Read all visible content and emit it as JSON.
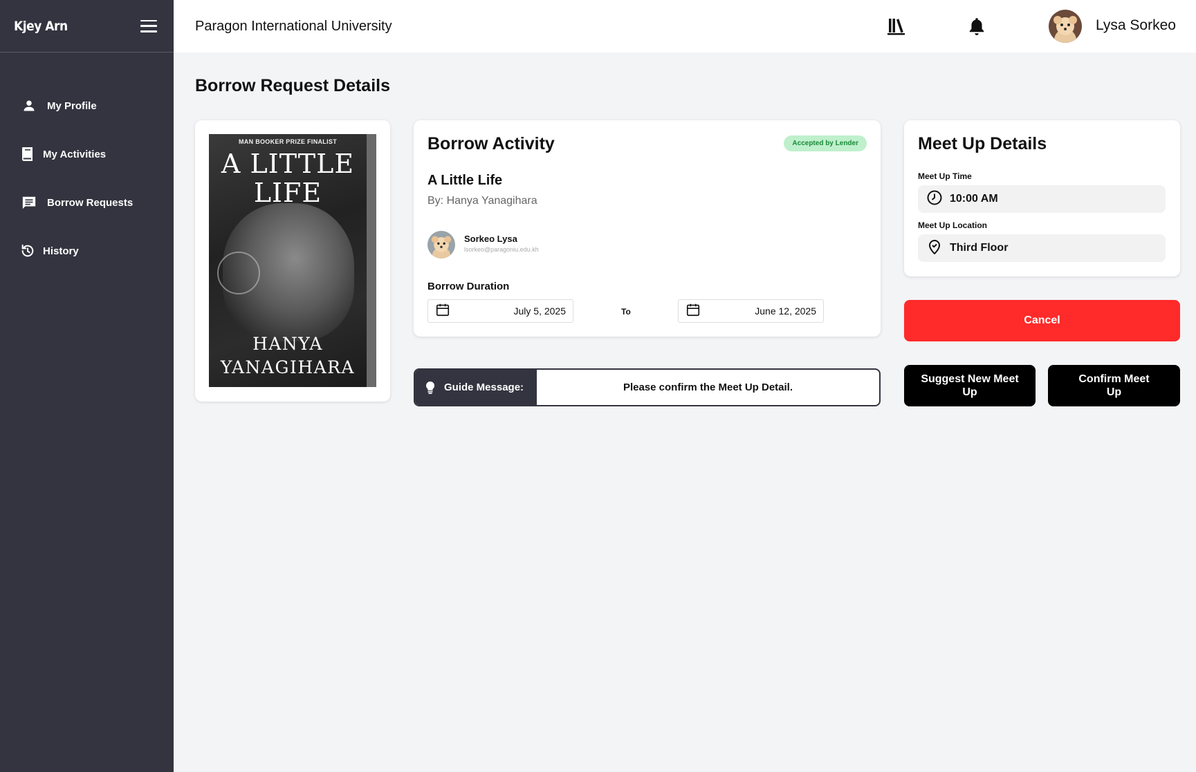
{
  "sidebar": {
    "brand": "Kjey Arn",
    "items": [
      {
        "label": "My Profile",
        "icon": "person-icon"
      },
      {
        "label": "My Activities",
        "icon": "book-icon"
      },
      {
        "label": "Borrow Requests",
        "icon": "chat-icon"
      },
      {
        "label": "History",
        "icon": "history-icon"
      }
    ]
  },
  "header": {
    "university": "Paragon International University",
    "user_name": "Lysa Sorkeo"
  },
  "page": {
    "title": "Borrow Request Details"
  },
  "book_cover": {
    "top_line": "MAN BOOKER PRIZE FINALIST",
    "title_line1": "A LITTLE",
    "title_line2": "LIFE",
    "author_line1": "HANYA",
    "author_line2": "YANAGIHARA"
  },
  "activity": {
    "title": "Borrow Activity",
    "status": "Accepted by Lender",
    "status_color": "#1a8a3a",
    "book_title": "A Little Life",
    "book_author": "By: Hanya Yanagihara",
    "lender_name": "Sorkeo Lysa",
    "lender_email": "lsorkeo@paragoniu.edu.kh",
    "duration_label": "Borrow Duration",
    "start_date": "July 5, 2025",
    "to_label": "To",
    "end_date": "June 12, 2025"
  },
  "meetup": {
    "title": "Meet Up Details",
    "time_label": "Meet Up Time",
    "time_value": "10:00 AM",
    "location_label": "Meet Up Location",
    "location_value": "Third Floor"
  },
  "guide": {
    "label": "Guide Message:",
    "message": "Please confirm the Meet Up Detail."
  },
  "actions": {
    "cancel": "Cancel",
    "suggest": "Suggest New Meet Up",
    "confirm": "Confirm Meet Up",
    "cancel_color": "#ff2a2a"
  }
}
